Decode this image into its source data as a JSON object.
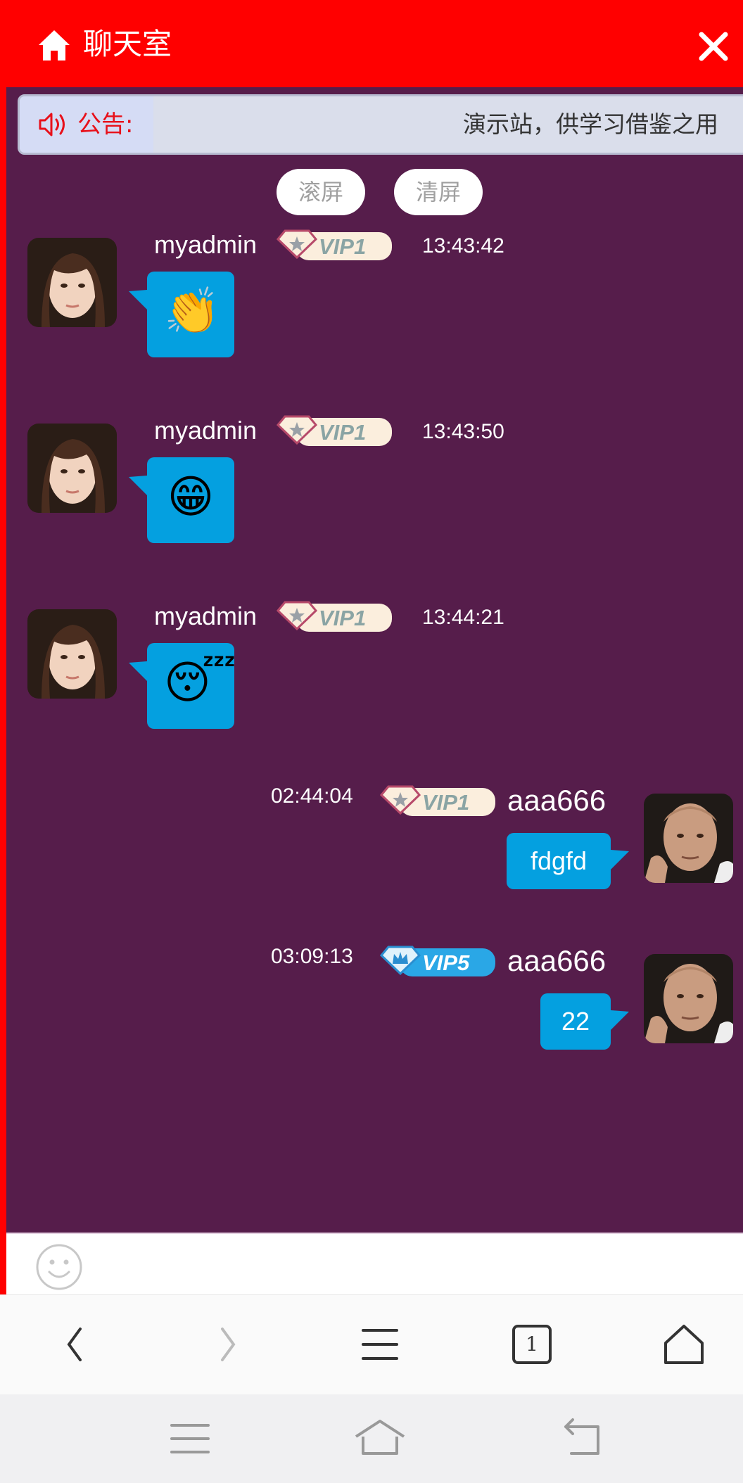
{
  "header": {
    "title": "聊天室"
  },
  "notice": {
    "label": "公告:",
    "text": "演示站，供学习借鉴之用"
  },
  "controls": {
    "scroll_label": "滚屏",
    "clear_label": "清屏"
  },
  "colors": {
    "header_bg": "#ff0000",
    "chat_bg": "#561d4b",
    "bubble": "#04a0e0",
    "notice_text": "#e8101a"
  },
  "messages": [
    {
      "user": "myadmin",
      "vip": "VIP1",
      "time": "13:43:42",
      "content_type": "emoji",
      "content": "👏",
      "side": "left"
    },
    {
      "user": "myadmin",
      "vip": "VIP1",
      "time": "13:43:50",
      "content_type": "emoji",
      "content": "😁",
      "side": "left"
    },
    {
      "user": "myadmin",
      "vip": "VIP1",
      "time": "13:44:21",
      "content_type": "emoji",
      "content": "😴",
      "side": "left"
    },
    {
      "user": "aaa666",
      "vip": "VIP1",
      "time": "02:44:04",
      "content_type": "text",
      "content": "fdgfd",
      "side": "right"
    },
    {
      "user": "aaa666",
      "vip": "VIP5",
      "time": "03:09:13",
      "content_type": "text",
      "content": "22",
      "side": "right"
    }
  ],
  "browser_bar": {
    "tab_count": "1"
  },
  "icons": [
    "home-icon",
    "close-icon",
    "speaker-icon",
    "smiley-icon",
    "back-icon",
    "forward-icon",
    "menu-icon",
    "tabs-icon",
    "home-outline-icon"
  ]
}
